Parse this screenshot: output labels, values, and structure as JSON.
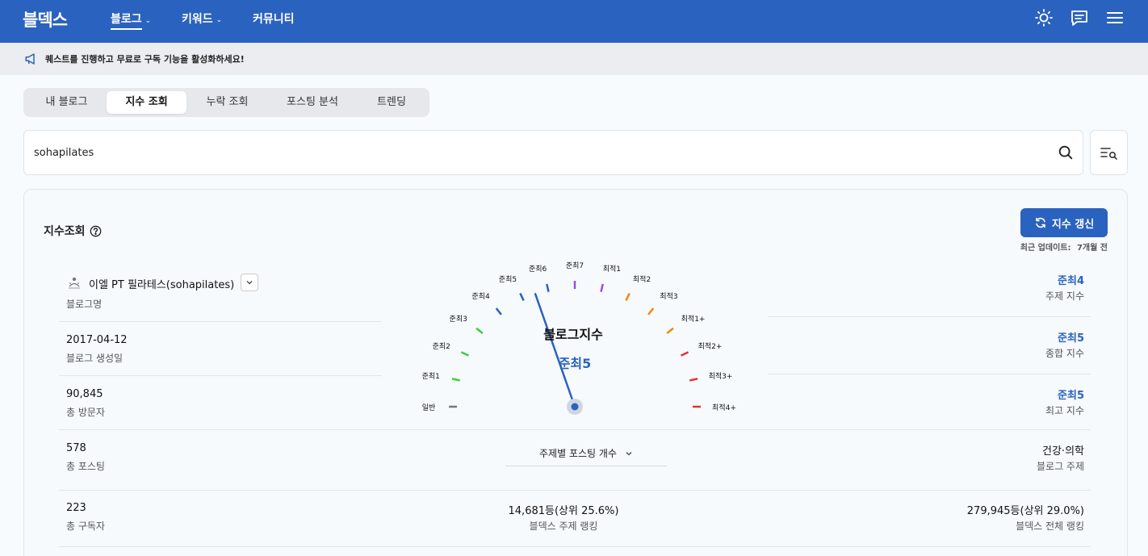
{
  "nav": {
    "logo": "블덱스",
    "items": [
      {
        "label": "블로그",
        "chevron": "⌄"
      },
      {
        "label": "키워드",
        "chevron": "⌄"
      },
      {
        "label": "커뮤니티"
      }
    ],
    "icons": [
      "sun-icon",
      "chat-icon",
      "menu-icon"
    ]
  },
  "notice": {
    "text": "퀘스트를 진행하고 무료로 구독 기능을 활성화하세요!"
  },
  "tabs": [
    "내 블로그",
    "지수 조회",
    "누락 조회",
    "포스팅 분석",
    "트렌딩"
  ],
  "search": {
    "value": "sohapilates"
  },
  "card": {
    "title": "지수조회",
    "refresh_label": "지수 갱신",
    "updated_label": "최근 업데이트:",
    "updated_value": "7개월 전"
  },
  "left": {
    "blog_name": "이엘 PT 필라테스(sohapilates)",
    "blog_name_label": "블로그명",
    "created": "2017-04-12",
    "created_label": "블로그 생성일",
    "visitors": "90,845",
    "visitors_label": "총 방문자",
    "posts": "578",
    "posts_label": "총 포스팅",
    "subscribers": "223",
    "subscribers_label": "총 구독자"
  },
  "gauge": {
    "title": "블로그지수",
    "value": "준최5",
    "level_index": 6,
    "labels": [
      "일반",
      "준최1",
      "준최2",
      "준최3",
      "준최4",
      "준최5",
      "준최6",
      "준최7",
      "최적1",
      "최적2",
      "최적3",
      "최적1+",
      "최적2+",
      "최적3+",
      "최적4+"
    ],
    "colors": [
      "#777777",
      "#3bcf3b",
      "#3bcf3b",
      "#3bcf3b",
      "#2a62bf",
      "#2a62bf",
      "#2a62bf",
      "#9b4fd6",
      "#9b4fd6",
      "#ee8a12",
      "#ee8a12",
      "#ee8a12",
      "#e83030",
      "#e83030",
      "#e83030"
    ]
  },
  "right": {
    "topic_index": "준최4",
    "topic_index_label": "주제 지수",
    "total_index": "준최5",
    "total_index_label": "종합 지수",
    "max_index": "준최5",
    "max_index_label": "최고 지수",
    "topic": "건강·의학",
    "topic_label": "블로그 주제",
    "total_rank": "279,945등(상위 29.0%)",
    "total_rank_label": "블덱스 전체 랭킹"
  },
  "center": {
    "topic_select": "주제별 포스팅 개수",
    "topic_rank": "14,681등(상위 25.6%)",
    "topic_rank_label": "블덱스 주제 랭킹"
  }
}
